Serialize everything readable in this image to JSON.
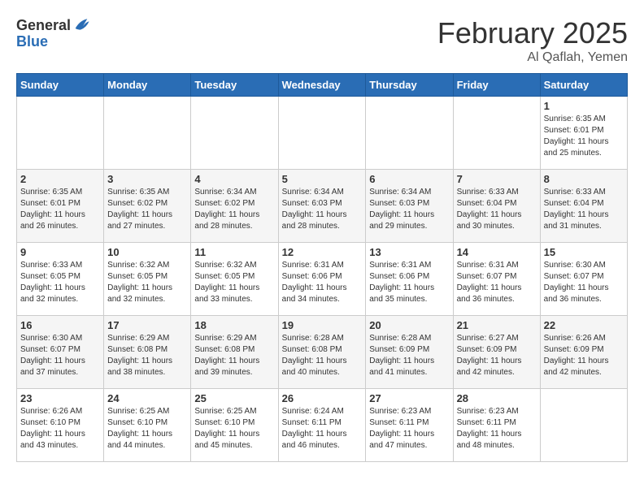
{
  "header": {
    "logo_general": "General",
    "logo_blue": "Blue",
    "month": "February 2025",
    "location": "Al Qaflah, Yemen"
  },
  "weekdays": [
    "Sunday",
    "Monday",
    "Tuesday",
    "Wednesday",
    "Thursday",
    "Friday",
    "Saturday"
  ],
  "weeks": [
    [
      {
        "day": "",
        "info": ""
      },
      {
        "day": "",
        "info": ""
      },
      {
        "day": "",
        "info": ""
      },
      {
        "day": "",
        "info": ""
      },
      {
        "day": "",
        "info": ""
      },
      {
        "day": "",
        "info": ""
      },
      {
        "day": "1",
        "info": "Sunrise: 6:35 AM\nSunset: 6:01 PM\nDaylight: 11 hours\nand 25 minutes."
      }
    ],
    [
      {
        "day": "2",
        "info": "Sunrise: 6:35 AM\nSunset: 6:01 PM\nDaylight: 11 hours\nand 26 minutes."
      },
      {
        "day": "3",
        "info": "Sunrise: 6:35 AM\nSunset: 6:02 PM\nDaylight: 11 hours\nand 27 minutes."
      },
      {
        "day": "4",
        "info": "Sunrise: 6:34 AM\nSunset: 6:02 PM\nDaylight: 11 hours\nand 28 minutes."
      },
      {
        "day": "5",
        "info": "Sunrise: 6:34 AM\nSunset: 6:03 PM\nDaylight: 11 hours\nand 28 minutes."
      },
      {
        "day": "6",
        "info": "Sunrise: 6:34 AM\nSunset: 6:03 PM\nDaylight: 11 hours\nand 29 minutes."
      },
      {
        "day": "7",
        "info": "Sunrise: 6:33 AM\nSunset: 6:04 PM\nDaylight: 11 hours\nand 30 minutes."
      },
      {
        "day": "8",
        "info": "Sunrise: 6:33 AM\nSunset: 6:04 PM\nDaylight: 11 hours\nand 31 minutes."
      }
    ],
    [
      {
        "day": "9",
        "info": "Sunrise: 6:33 AM\nSunset: 6:05 PM\nDaylight: 11 hours\nand 32 minutes."
      },
      {
        "day": "10",
        "info": "Sunrise: 6:32 AM\nSunset: 6:05 PM\nDaylight: 11 hours\nand 32 minutes."
      },
      {
        "day": "11",
        "info": "Sunrise: 6:32 AM\nSunset: 6:05 PM\nDaylight: 11 hours\nand 33 minutes."
      },
      {
        "day": "12",
        "info": "Sunrise: 6:31 AM\nSunset: 6:06 PM\nDaylight: 11 hours\nand 34 minutes."
      },
      {
        "day": "13",
        "info": "Sunrise: 6:31 AM\nSunset: 6:06 PM\nDaylight: 11 hours\nand 35 minutes."
      },
      {
        "day": "14",
        "info": "Sunrise: 6:31 AM\nSunset: 6:07 PM\nDaylight: 11 hours\nand 36 minutes."
      },
      {
        "day": "15",
        "info": "Sunrise: 6:30 AM\nSunset: 6:07 PM\nDaylight: 11 hours\nand 36 minutes."
      }
    ],
    [
      {
        "day": "16",
        "info": "Sunrise: 6:30 AM\nSunset: 6:07 PM\nDaylight: 11 hours\nand 37 minutes."
      },
      {
        "day": "17",
        "info": "Sunrise: 6:29 AM\nSunset: 6:08 PM\nDaylight: 11 hours\nand 38 minutes."
      },
      {
        "day": "18",
        "info": "Sunrise: 6:29 AM\nSunset: 6:08 PM\nDaylight: 11 hours\nand 39 minutes."
      },
      {
        "day": "19",
        "info": "Sunrise: 6:28 AM\nSunset: 6:08 PM\nDaylight: 11 hours\nand 40 minutes."
      },
      {
        "day": "20",
        "info": "Sunrise: 6:28 AM\nSunset: 6:09 PM\nDaylight: 11 hours\nand 41 minutes."
      },
      {
        "day": "21",
        "info": "Sunrise: 6:27 AM\nSunset: 6:09 PM\nDaylight: 11 hours\nand 42 minutes."
      },
      {
        "day": "22",
        "info": "Sunrise: 6:26 AM\nSunset: 6:09 PM\nDaylight: 11 hours\nand 42 minutes."
      }
    ],
    [
      {
        "day": "23",
        "info": "Sunrise: 6:26 AM\nSunset: 6:10 PM\nDaylight: 11 hours\nand 43 minutes."
      },
      {
        "day": "24",
        "info": "Sunrise: 6:25 AM\nSunset: 6:10 PM\nDaylight: 11 hours\nand 44 minutes."
      },
      {
        "day": "25",
        "info": "Sunrise: 6:25 AM\nSunset: 6:10 PM\nDaylight: 11 hours\nand 45 minutes."
      },
      {
        "day": "26",
        "info": "Sunrise: 6:24 AM\nSunset: 6:11 PM\nDaylight: 11 hours\nand 46 minutes."
      },
      {
        "day": "27",
        "info": "Sunrise: 6:23 AM\nSunset: 6:11 PM\nDaylight: 11 hours\nand 47 minutes."
      },
      {
        "day": "28",
        "info": "Sunrise: 6:23 AM\nSunset: 6:11 PM\nDaylight: 11 hours\nand 48 minutes."
      },
      {
        "day": "",
        "info": ""
      }
    ]
  ]
}
